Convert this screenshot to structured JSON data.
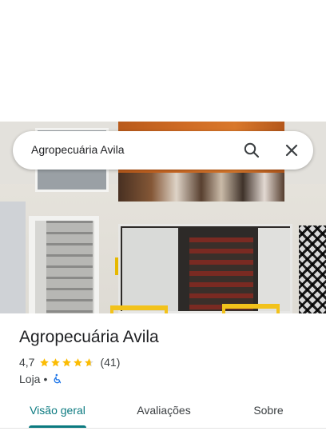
{
  "search": {
    "query": "Agropecuária Avila",
    "search_icon": "search-icon",
    "close_icon": "close-icon"
  },
  "place": {
    "name": "Agropecuária Avila",
    "rating": "4,7",
    "rating_value": 4.7,
    "rating_max": 5,
    "reviews_count": "(41)",
    "category": "Loja",
    "separator": "•",
    "accessibility_icon": "wheelchair-accessible-icon"
  },
  "tabs": [
    {
      "label": "Visão geral",
      "active": true
    },
    {
      "label": "Avaliações",
      "active": false
    },
    {
      "label": "Sobre",
      "active": false
    }
  ],
  "colors": {
    "accent": "#0b7a80",
    "star": "#fbbc04",
    "access": "#1a73e8"
  }
}
